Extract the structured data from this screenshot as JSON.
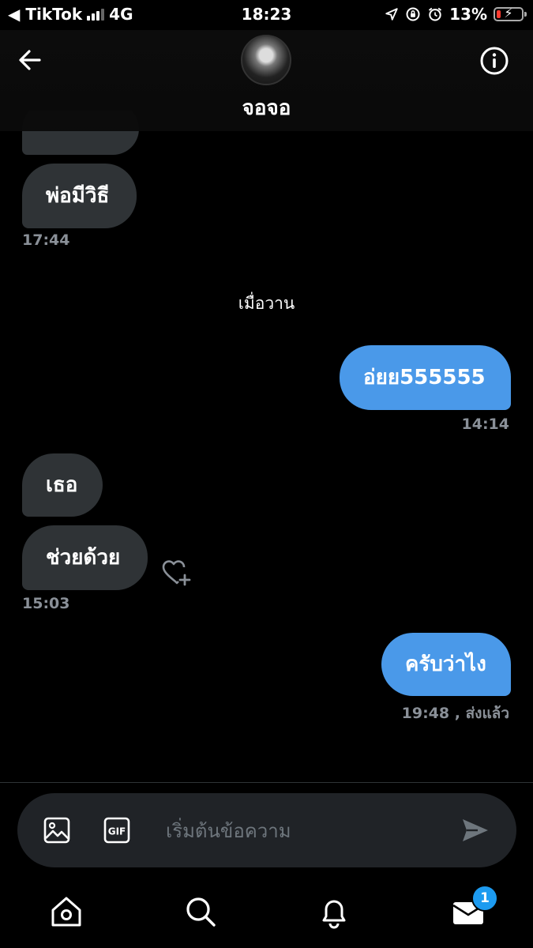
{
  "status_bar": {
    "back_app": "◀ TikTok",
    "network": "4G",
    "time": "18:23",
    "battery": "13%"
  },
  "header": {
    "contact_name": "จอจอ"
  },
  "messages": [
    {
      "direction": "in",
      "text": "พ่อมีวิธี",
      "time": "17:44"
    },
    {
      "direction": "out",
      "text": "อ่ยย555555",
      "time": "14:14"
    },
    {
      "direction": "in",
      "text": "เธอ"
    },
    {
      "direction": "in",
      "text": "ช่วยด้วย",
      "time": "15:03"
    },
    {
      "direction": "out",
      "text": "ครับว่าไง",
      "time": "19:48",
      "status": ", ส่งแล้ว"
    }
  ],
  "day_separator": "เมื่อวาน",
  "composer": {
    "placeholder": "เริ่มต้นข้อความ",
    "gif_label": "GIF"
  },
  "nav": {
    "messages_badge": "1"
  },
  "colors": {
    "outgoing_bubble": "#4a99e9",
    "incoming_bubble": "#2f3336",
    "accent": "#1d9bf0"
  },
  "icons": [
    "arrow-left-icon",
    "info-icon",
    "heart-plus-icon",
    "image-icon",
    "gif-icon",
    "send-icon",
    "home-icon",
    "search-icon",
    "bell-icon",
    "mail-icon"
  ]
}
